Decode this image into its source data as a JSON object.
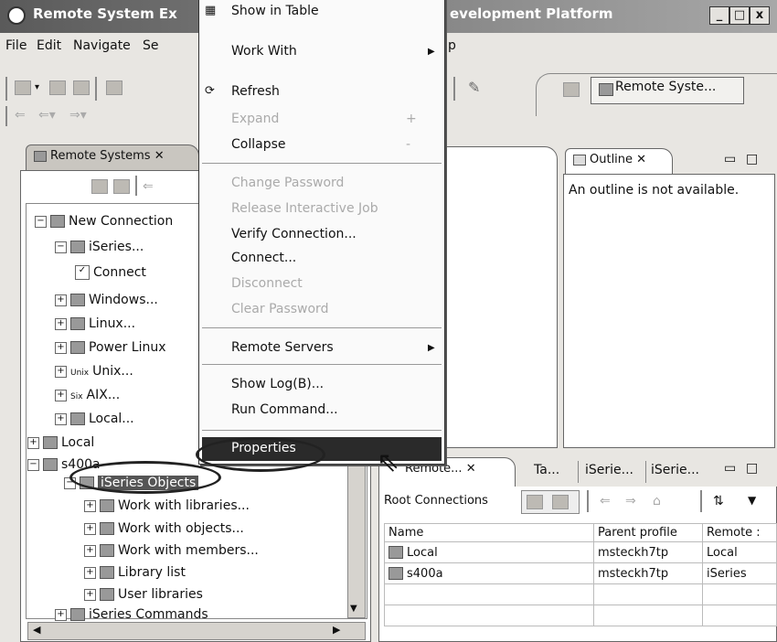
{
  "window": {
    "title": "Remote System Ex",
    "title_right": "evelopment Platform",
    "min_label": "_",
    "max_label": "□",
    "close_label": "x"
  },
  "menubar": {
    "items": [
      "File",
      "Edit",
      "Navigate",
      "Se",
      "p"
    ]
  },
  "toolbar": {
    "perspective_label": "Remote Syste..."
  },
  "remote_systems_view": {
    "tab_label": "Remote Systems",
    "tab_close": "✕",
    "tree": [
      {
        "label": "New Connection",
        "expander": "−"
      },
      {
        "label": "iSeries...",
        "expander": "−"
      },
      {
        "label": "Connect",
        "expander": ""
      },
      {
        "label": "Windows...",
        "expander": "+"
      },
      {
        "label": "Linux...",
        "expander": "+"
      },
      {
        "label": "Power Linux",
        "expander": "+"
      },
      {
        "label": "Unix...",
        "expander": "+"
      },
      {
        "label": "AIX...",
        "expander": "+"
      },
      {
        "label": "Local...",
        "expander": "+"
      },
      {
        "label": "Local",
        "expander": "+"
      },
      {
        "label": "s400a",
        "expander": "−"
      },
      {
        "label": "iSeries Objects",
        "expander": "−"
      },
      {
        "label": "Work with libraries...",
        "expander": "+"
      },
      {
        "label": "Work with objects...",
        "expander": "+"
      },
      {
        "label": "Work with members...",
        "expander": "+"
      },
      {
        "label": "Library list",
        "expander": "+"
      },
      {
        "label": "User libraries",
        "expander": "+"
      },
      {
        "label": "iSeries Commands",
        "expander": "+"
      }
    ],
    "icon_prefixes": {
      "unix": "Unix",
      "aix": "Six"
    }
  },
  "outline_view": {
    "tab_label": "Outline",
    "tab_close": "✕",
    "message": "An outline is not available."
  },
  "context_menu": {
    "items": [
      {
        "label": "Show in Table",
        "enabled": true,
        "submenu": false
      },
      {
        "label": "Work With",
        "enabled": true,
        "submenu": true
      },
      {
        "label": "Refresh",
        "enabled": true,
        "submenu": false
      },
      {
        "label": "Expand",
        "enabled": false,
        "submenu": false,
        "accel": "+"
      },
      {
        "label": "Collapse",
        "enabled": true,
        "submenu": false,
        "accel": "-"
      },
      {
        "label": "Change Password",
        "enabled": false,
        "submenu": false
      },
      {
        "label": "Release Interactive Job",
        "enabled": false,
        "submenu": false
      },
      {
        "label": "Verify Connection...",
        "enabled": true,
        "submenu": false
      },
      {
        "label": "Connect...",
        "enabled": true,
        "submenu": false
      },
      {
        "label": "Disconnect",
        "enabled": false,
        "submenu": false
      },
      {
        "label": "Clear Password",
        "enabled": false,
        "submenu": false
      },
      {
        "label": "Remote Servers",
        "enabled": true,
        "submenu": true
      },
      {
        "label": "Show Log(B)...",
        "enabled": true,
        "submenu": false
      },
      {
        "label": "Run Command...",
        "enabled": true,
        "submenu": false
      },
      {
        "label": "Properties",
        "enabled": true,
        "submenu": false,
        "highlighted": true
      }
    ]
  },
  "bottom_view": {
    "tabs": [
      "Remote... ✕",
      "Ta...",
      "iSerie...",
      "iSerie..."
    ],
    "root_label": "Root Connections",
    "columns": [
      "Name",
      "Parent profile",
      "Remote :"
    ],
    "rows": [
      [
        "Local",
        "msteckh7tp",
        "Local"
      ],
      [
        "s400a",
        "msteckh7tp",
        "iSeries"
      ]
    ]
  },
  "colors": {
    "menu_highlight": "#2a2a2a",
    "title_dark": "#5a5a5a"
  }
}
